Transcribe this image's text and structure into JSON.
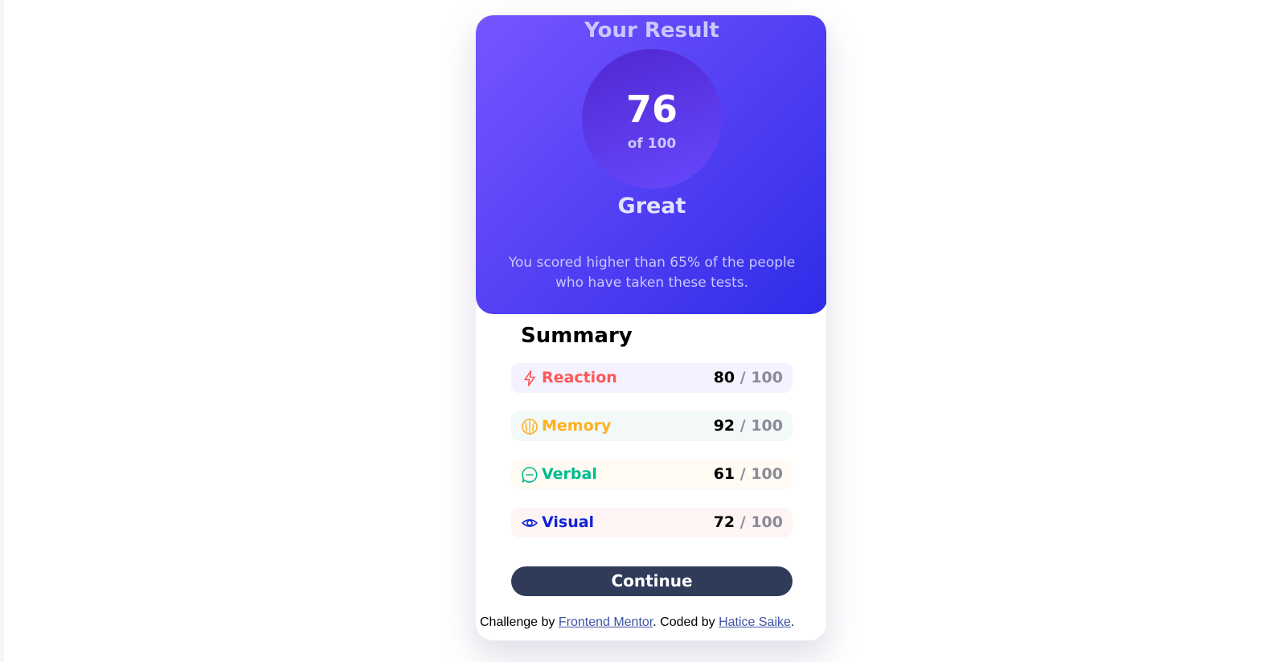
{
  "result": {
    "title": "Your Result",
    "score": "76",
    "score_of": "of 100",
    "rating": "Great",
    "description": "You scored higher than 65% of the people who have taken these tests."
  },
  "summary": {
    "title": "Summary",
    "items": [
      {
        "label": "Reaction",
        "score": "80",
        "max": "/ 100",
        "icon": "lightning-icon",
        "color": "#ff5757",
        "bg": "#f3f2fe"
      },
      {
        "label": "Memory",
        "score": "92",
        "max": "/ 100",
        "icon": "brain-icon",
        "color": "#ffb01f",
        "bg": "#f2f9f8"
      },
      {
        "label": "Verbal",
        "score": "61",
        "max": "/ 100",
        "icon": "chat-bubble-icon",
        "color": "#00bb8f",
        "bg": "#fffaf2"
      },
      {
        "label": "Visual",
        "score": "72",
        "max": "/ 100",
        "icon": "eye-icon",
        "color": "#1125d6",
        "bg": "#fef4f3"
      }
    ],
    "continue_label": "Continue"
  },
  "footer": {
    "prefix": "Challenge by ",
    "link1": "Frontend Mentor",
    "middle": ". Coded by ",
    "link2": "Hatice Saike",
    "suffix": "."
  }
}
